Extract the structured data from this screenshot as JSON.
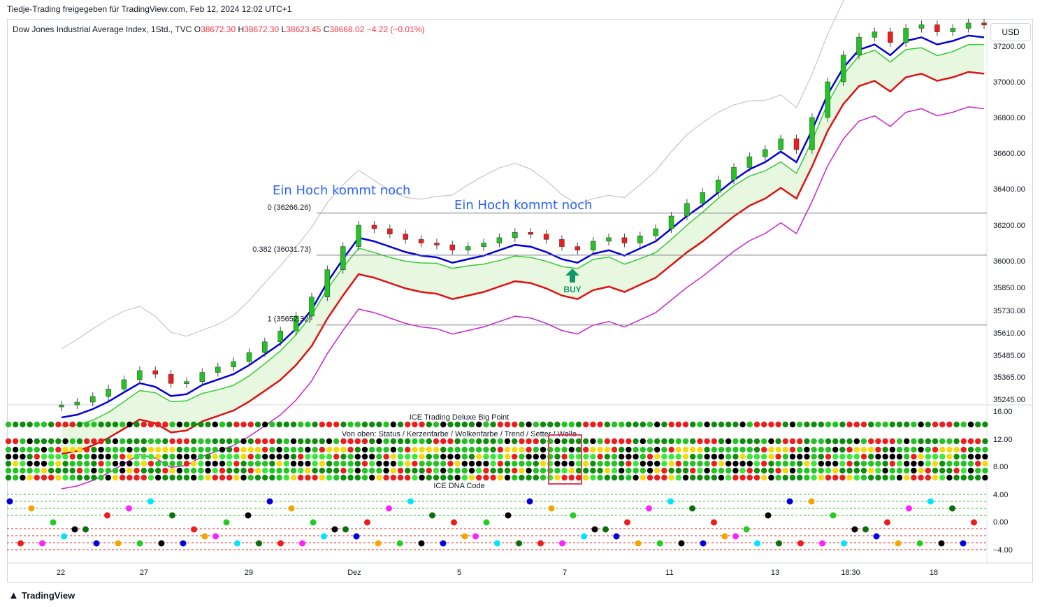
{
  "header": {
    "shared_by": "Tiedje-Trading freigegeben für TradingView.com, Feb 12, 2024 12:02 UTC+1"
  },
  "legend": {
    "symbol": "Dow Jones Industrial Average Index, 1Std., TVC",
    "o_label": "O",
    "o": "38672.30",
    "h_label": "H",
    "h": "38672.30",
    "l_label": "L",
    "l": "38623.45",
    "c_label": "C",
    "c": "38668.02",
    "change": "−4.22 (−0.01%)"
  },
  "currency_button": "USD",
  "footer": {
    "brand": "TradingView",
    "logo_icon": "tradingview-logo-icon"
  },
  "colors": {
    "up": "#22c322",
    "down": "#ee1c1c",
    "blue_line": "#0000dd",
    "red_line": "#e01010",
    "green_line": "#33cc33",
    "magenta_line": "#cc22cc",
    "gray_line": "#bbbbbb",
    "cloud": "#e8f8e0",
    "annotation_blue": "#2962ff",
    "buy_arrow": "#12966c"
  },
  "chart_data": [
    {
      "type": "candlestick",
      "title": "",
      "y_ticks": [
        "37200.00",
        "37000.00",
        "36800.00",
        "36600.00",
        "36400.00",
        "36200.00",
        "36000.00",
        "35850.00",
        "35730.00",
        "35610.00",
        "35485.00",
        "35365.00",
        "35245.00"
      ],
      "x_ticks": [
        "22",
        "27",
        "29",
        "Dez",
        "5",
        "7",
        "11",
        "13",
        "18:30",
        "18"
      ],
      "fib_levels": [
        {
          "label": "0 (36266.26)",
          "value": 36266.26
        },
        {
          "label": "0.382 (36031.73)",
          "value": 36031.73
        },
        {
          "label": "1 (35652.32)",
          "value": 35652.32
        }
      ],
      "annotations": [
        {
          "text": "Ein Hoch kommt noch"
        },
        {
          "text": "Ein Hoch kommt noch"
        },
        {
          "text": "BUY"
        }
      ],
      "close_path": [
        35215,
        35230,
        35260,
        35300,
        35350,
        35400,
        35380,
        35330,
        35340,
        35390,
        35420,
        35450,
        35500,
        35560,
        35620,
        35700,
        35800,
        35950,
        36080,
        36200,
        36180,
        36150,
        36120,
        36100,
        36090,
        36060,
        36080,
        36100,
        36130,
        36160,
        36150,
        36120,
        36080,
        36060,
        36110,
        36130,
        36100,
        36140,
        36180,
        36250,
        36320,
        36380,
        36450,
        36520,
        36580,
        36620,
        36680,
        36620,
        36800,
        37000,
        37150,
        37250,
        37280,
        37220,
        37300,
        37320,
        37280,
        37300,
        37330,
        37320
      ]
    },
    {
      "type": "table",
      "title": "ICE Trading Deluxe Big Point",
      "subtitle": "Von oben: Status / Kerzenfarbe / Wolkenfarbe / Trend / Setter / Welle",
      "y_ticks": [
        "16.00",
        "12.00",
        "8.00"
      ]
    },
    {
      "type": "scatter",
      "title": "ICE DNA Code",
      "y_ticks": [
        "4.00",
        "0.00",
        "−4.00"
      ]
    }
  ]
}
